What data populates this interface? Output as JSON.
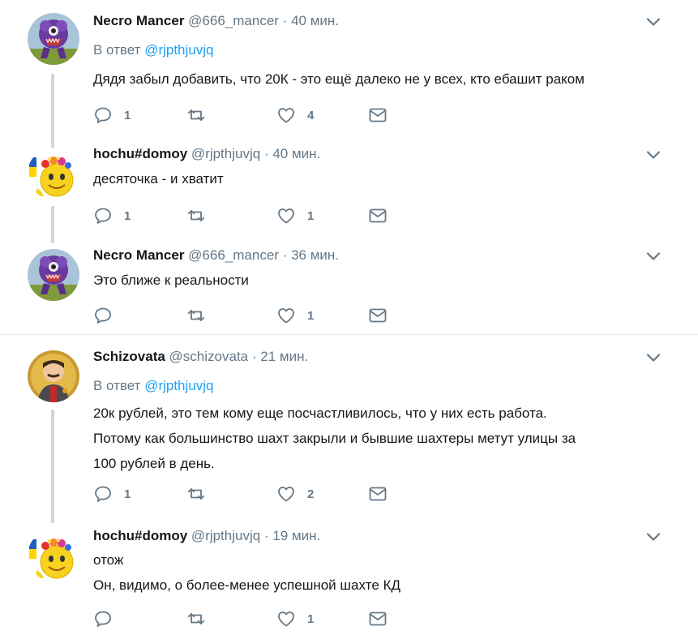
{
  "colors": {
    "accent": "#1da1f2",
    "muted": "#657786",
    "text": "#14171a",
    "thread_line": "#ccd6dd"
  },
  "tweets": [
    {
      "name": "Necro Mancer",
      "handle": "@666_mancer",
      "dot": "·",
      "time": "40 мин.",
      "reply_prefix": "В ответ",
      "reply_to": "@rjpthjuvjq",
      "text": "Дядя забыл добавить, что 20К - это ещё далеко не у всех, кто ебашит раком",
      "replies": "1",
      "retweets": "",
      "likes": "4",
      "avatar_icon": "purple-monster-avatar"
    },
    {
      "name": "hochu#domoy",
      "handle": "@rjpthjuvjq",
      "dot": "·",
      "time": "40 мин.",
      "text": "десяточка - и хватит",
      "replies": "1",
      "retweets": "",
      "likes": "1",
      "avatar_icon": "smiley-wreath-avatar"
    },
    {
      "name": "Necro Mancer",
      "handle": "@666_mancer",
      "dot": "·",
      "time": "36 мин.",
      "text": "Это ближе к реальности",
      "replies": "",
      "retweets": "",
      "likes": "1",
      "avatar_icon": "purple-monster-avatar"
    },
    {
      "name": "Schizovata",
      "handle": "@schizovata",
      "dot": "·",
      "time": "21 мин.",
      "reply_prefix": "В ответ",
      "reply_to": "@rjpthjuvjq",
      "text_lines": [
        "20к рублей, это тем кому еще посчастливилось, что у них есть работа.",
        "Потому как большинство шахт закрыли и бывшие шахтеры метут улицы за",
        "100 рублей в день."
      ],
      "replies": "1",
      "retweets": "",
      "likes": "2",
      "avatar_icon": "icon-portrait-avatar"
    },
    {
      "name": "hochu#domoy",
      "handle": "@rjpthjuvjq",
      "dot": "·",
      "time": "19 мин.",
      "text_lines": [
        "отож",
        "Он, видимо, о более-менее успешной шахте КД"
      ],
      "replies": "",
      "retweets": "",
      "likes": "1",
      "avatar_icon": "smiley-wreath-avatar"
    }
  ]
}
